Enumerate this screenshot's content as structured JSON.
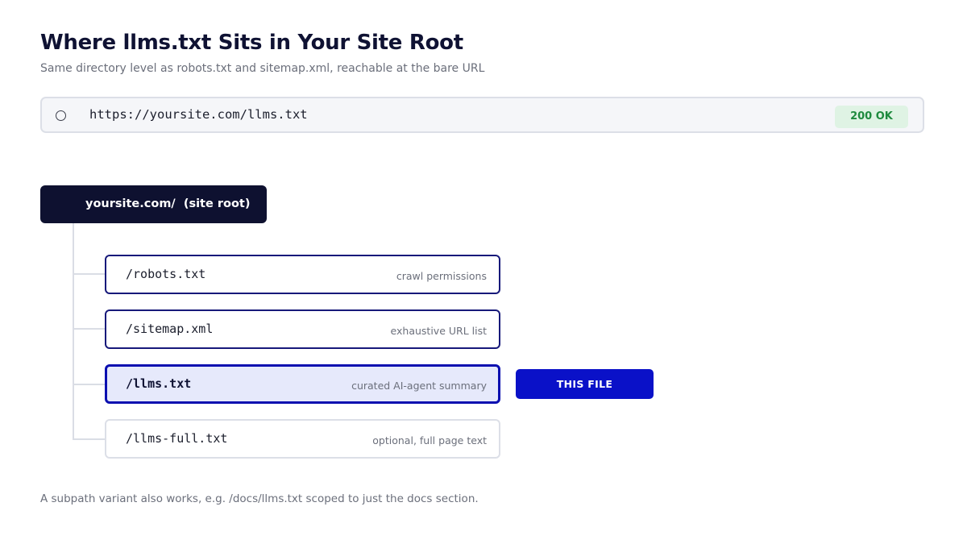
{
  "header": {
    "title": "Where llms.txt Sits in Your Site Root",
    "subtitle": "Same directory level as robots.txt and sitemap.xml, reachable at the bare URL"
  },
  "url_bar": {
    "icon": "circle-icon",
    "url": "https://yoursite.com/llms.txt",
    "status": "200 OK",
    "status_color": "#1e8a3e"
  },
  "tree": {
    "root_label": "yoursite.com/  (site root)",
    "files": [
      {
        "path": "/robots.txt",
        "description": "crawl permissions"
      },
      {
        "path": "/sitemap.xml",
        "description": "exhaustive URL list"
      },
      {
        "path": "/llms.txt",
        "description": "curated AI-agent summary",
        "highlighted": true
      },
      {
        "path": "/llms-full.txt",
        "description": "optional, full page text",
        "optional": true
      }
    ],
    "highlight_tag": "THIS FILE",
    "highlight_color": "#0a11c8",
    "root_color": "#0e1130"
  },
  "footnote": "A subpath variant also works, e.g. /docs/llms.txt scoped to just the docs section."
}
